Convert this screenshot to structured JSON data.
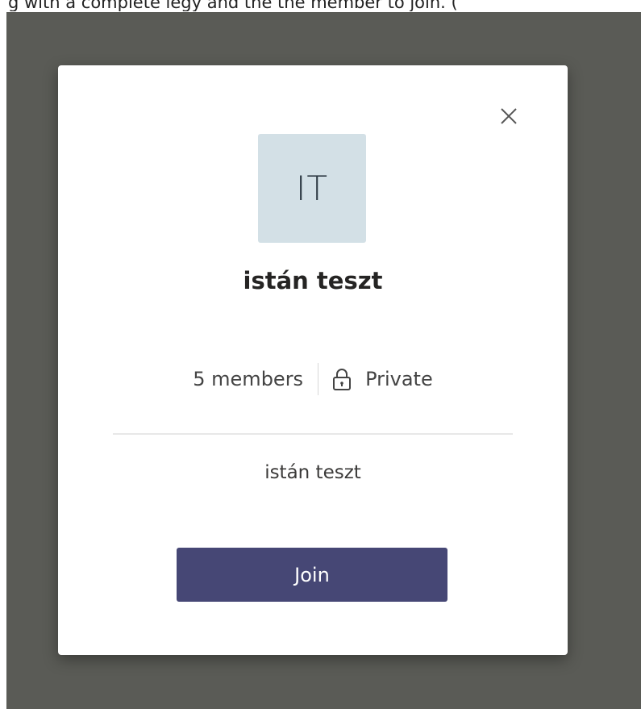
{
  "top_caption": "g with a complete legy and the the member to join. (",
  "dialog": {
    "avatar_initials": "IT",
    "team_name": "istán teszt",
    "members_label": "5 members",
    "privacy_label": "Private",
    "description": "istán teszt",
    "join_label": "Join",
    "icons": {
      "close": "close-icon",
      "lock": "lock-icon"
    }
  },
  "colors": {
    "backdrop": "#5a5b56",
    "avatar_bg": "#d3e0e6",
    "join_button": "#464775"
  }
}
